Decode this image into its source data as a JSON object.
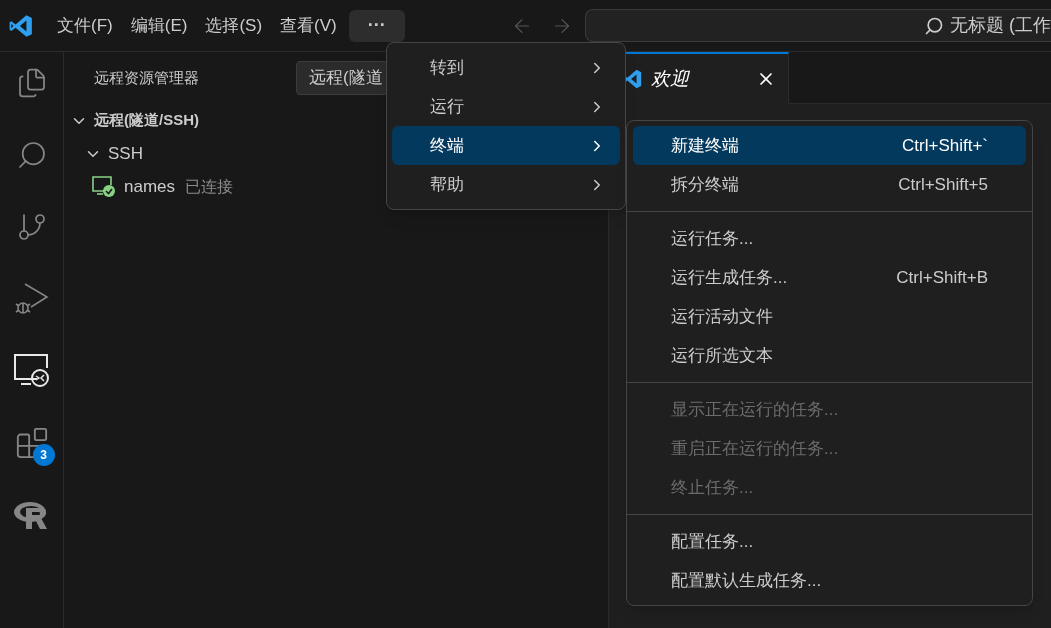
{
  "menu_bar": {
    "items": [
      {
        "label": "文件(F)"
      },
      {
        "label": "编辑(E)"
      },
      {
        "label": "选择(S)"
      },
      {
        "label": "查看(V)"
      }
    ],
    "more": {
      "label": "···",
      "selected": true
    }
  },
  "command_center": {
    "text": "无标题 (工作"
  },
  "activity_bar": {
    "items": [
      {
        "kind": "explorer",
        "selected": false
      },
      {
        "kind": "search",
        "selected": false
      },
      {
        "kind": "source-control",
        "selected": false
      },
      {
        "kind": "run-debug",
        "selected": false
      },
      {
        "kind": "remote",
        "selected": true
      },
      {
        "kind": "extensions",
        "selected": false,
        "badge": "3"
      },
      {
        "kind": "r",
        "selected": false
      }
    ]
  },
  "sidebar": {
    "title": "远程资源管理器",
    "dropdown": "远程(隧道",
    "tree": [
      {
        "label": "远程(隧道/SSH)",
        "expanded": true,
        "children": [
          {
            "label": "SSH",
            "expanded": true,
            "children": [
              {
                "label": "names",
                "status": "已连接",
                "connected": true
              }
            ]
          }
        ]
      }
    ]
  },
  "tabs": [
    {
      "label": "欢迎",
      "selected": true
    }
  ],
  "menu": [
    {
      "label": "转到",
      "selected": false
    },
    {
      "label": "运行",
      "selected": false
    },
    {
      "label": "终端",
      "selected": true
    },
    {
      "label": "帮助",
      "selected": false
    }
  ],
  "submenu": [
    [
      {
        "label": "新建终端",
        "shortcut": "Ctrl+Shift+`",
        "selected": true,
        "disabled": false
      },
      {
        "label": "拆分终端",
        "shortcut": "Ctrl+Shift+5",
        "selected": false,
        "disabled": false
      }
    ],
    [
      {
        "label": "运行任务...",
        "selected": false,
        "disabled": false
      },
      {
        "label": "运行生成任务...",
        "shortcut": "Ctrl+Shift+B",
        "selected": false,
        "disabled": false
      },
      {
        "label": "运行活动文件",
        "selected": false,
        "disabled": false
      },
      {
        "label": "运行所选文本",
        "selected": false,
        "disabled": false
      }
    ],
    [
      {
        "label": "显示正在运行的任务...",
        "selected": false,
        "disabled": true
      },
      {
        "label": "重启正在运行的任务...",
        "selected": false,
        "disabled": true
      },
      {
        "label": "终止任务...",
        "selected": false,
        "disabled": true
      }
    ],
    [
      {
        "label": "配置任务...",
        "selected": false,
        "disabled": false
      },
      {
        "label": "配置默认生成任务...",
        "selected": false,
        "disabled": false
      }
    ]
  ]
}
